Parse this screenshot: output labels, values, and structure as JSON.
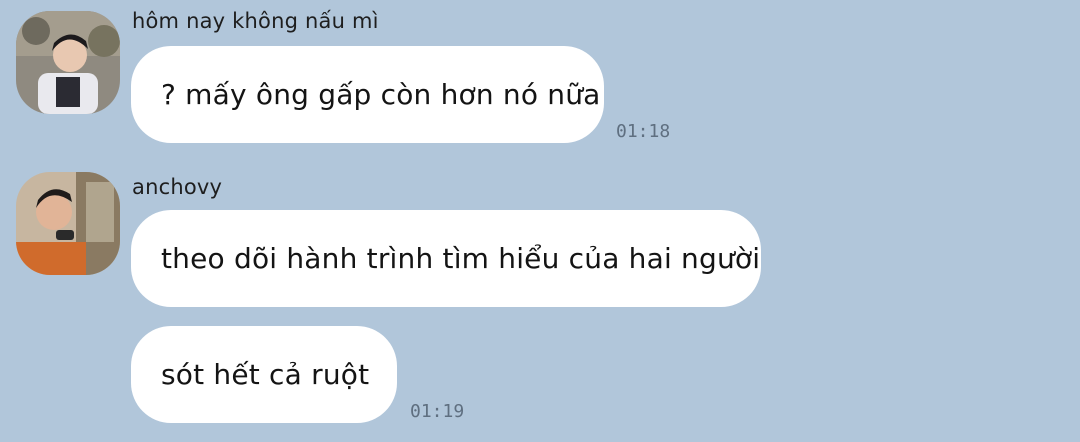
{
  "chat": {
    "groups": [
      {
        "sender": "hôm nay không nấu mì",
        "avatar_icon": "user-avatar-photo-icon",
        "messages": [
          {
            "text": "? mấy ông gấp còn hơn nó nữa",
            "time": "01:18"
          }
        ]
      },
      {
        "sender": "anchovy",
        "avatar_icon": "user-avatar-photo-icon",
        "messages": [
          {
            "text": "theo dõi hành trình tìm hiểu của hai người",
            "time": ""
          },
          {
            "text": "sót hết cả ruột",
            "time": "01:19"
          }
        ]
      }
    ]
  },
  "colors": {
    "background": "#b1c6da",
    "bubble": "#ffffff",
    "timestamp": "#5f6f80"
  }
}
